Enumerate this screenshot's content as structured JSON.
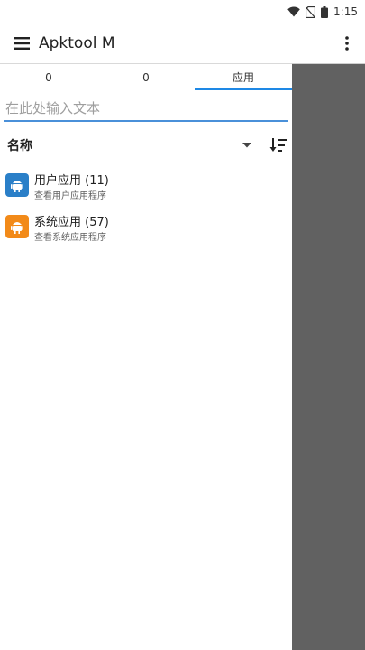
{
  "status_bar": {
    "time": "1:15",
    "icons": [
      "wifi-icon",
      "no-sim-icon",
      "battery-icon"
    ]
  },
  "app_bar": {
    "title": "Apktool M",
    "menu_icon": "hamburger-menu-icon",
    "overflow_icon": "more-vert-icon"
  },
  "tabs": [
    {
      "label": "0",
      "active": false
    },
    {
      "label": "0",
      "active": false
    },
    {
      "label": "应用",
      "active": true
    }
  ],
  "search": {
    "placeholder": "在此处输入文本",
    "value": ""
  },
  "sort": {
    "label": "名称",
    "dropdown_icon": "arrow-drop-down-icon",
    "order_icon": "sort-order-icon"
  },
  "list": {
    "items": [
      {
        "title": "用户应用 (11)",
        "subtitle": "查看用户应用程序",
        "icon": "android-icon",
        "color": "#2a7fc8"
      },
      {
        "title": "系统应用 (57)",
        "subtitle": "查看系统应用程序",
        "icon": "android-icon",
        "color": "#f28a19"
      }
    ]
  },
  "colors": {
    "accent": "#1e88e5",
    "right_pane": "#616161"
  }
}
